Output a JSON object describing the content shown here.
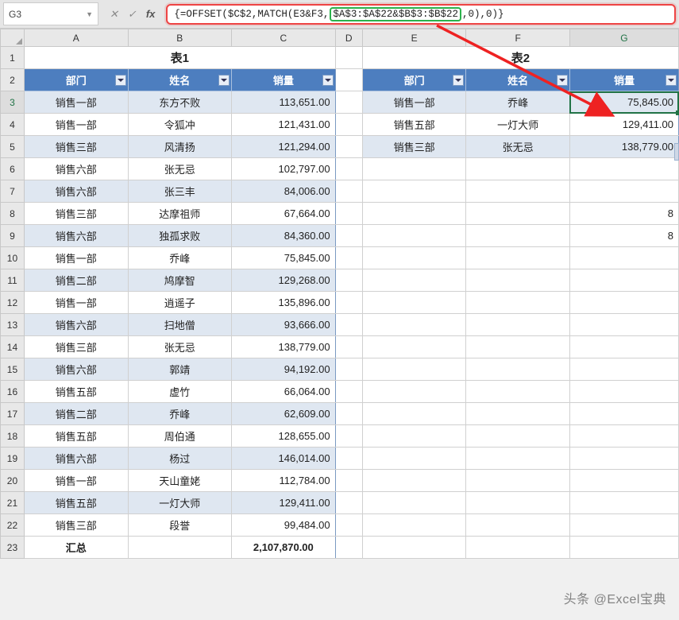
{
  "name_box": "G3",
  "formula": {
    "pre": "{=OFFSET($C$2,MATCH(E3&F3,",
    "hl": "$A$3:$A$22&$B$3:$B$22",
    "post": ",0),0)}"
  },
  "columns": [
    "A",
    "B",
    "C",
    "D",
    "E",
    "F",
    "G"
  ],
  "row_numbers": [
    "1",
    "2",
    "3",
    "4",
    "5",
    "6",
    "7",
    "8",
    "9",
    "10",
    "11",
    "12",
    "13",
    "14",
    "15",
    "16",
    "17",
    "18",
    "19",
    "20",
    "21",
    "22",
    "23"
  ],
  "title_left": "表1",
  "title_right": "表2",
  "headers": {
    "dept": "部门",
    "name": "姓名",
    "sales": "销量"
  },
  "table1": [
    {
      "dept": "销售一部",
      "name": "东方不败",
      "sales": "113,651.00"
    },
    {
      "dept": "销售一部",
      "name": "令狐冲",
      "sales": "121,431.00"
    },
    {
      "dept": "销售三部",
      "name": "风清扬",
      "sales": "121,294.00"
    },
    {
      "dept": "销售六部",
      "name": "张无忌",
      "sales": "102,797.00"
    },
    {
      "dept": "销售六部",
      "name": "张三丰",
      "sales": "84,006.00"
    },
    {
      "dept": "销售三部",
      "name": "达摩祖师",
      "sales": "67,664.00"
    },
    {
      "dept": "销售六部",
      "name": "独孤求败",
      "sales": "84,360.00"
    },
    {
      "dept": "销售一部",
      "name": "乔峰",
      "sales": "75,845.00"
    },
    {
      "dept": "销售二部",
      "name": "鸠摩智",
      "sales": "129,268.00"
    },
    {
      "dept": "销售一部",
      "name": "逍遥子",
      "sales": "135,896.00"
    },
    {
      "dept": "销售六部",
      "name": "扫地僧",
      "sales": "93,666.00"
    },
    {
      "dept": "销售三部",
      "name": "张无忌",
      "sales": "138,779.00"
    },
    {
      "dept": "销售六部",
      "name": "郭靖",
      "sales": "94,192.00"
    },
    {
      "dept": "销售五部",
      "name": "虚竹",
      "sales": "66,064.00"
    },
    {
      "dept": "销售二部",
      "name": "乔峰",
      "sales": "62,609.00"
    },
    {
      "dept": "销售五部",
      "name": "周伯通",
      "sales": "128,655.00"
    },
    {
      "dept": "销售六部",
      "name": "杨过",
      "sales": "146,014.00"
    },
    {
      "dept": "销售一部",
      "name": "天山童姥",
      "sales": "112,784.00"
    },
    {
      "dept": "销售五部",
      "name": "一灯大师",
      "sales": "129,411.00"
    },
    {
      "dept": "销售三部",
      "name": "段誉",
      "sales": "99,484.00"
    }
  ],
  "total_row": {
    "label": "汇总",
    "dept": "",
    "sales": "2,107,870.00"
  },
  "table2": [
    {
      "dept": "销售一部",
      "name": "乔峰",
      "sales": "75,845.00"
    },
    {
      "dept": "销售五部",
      "name": "一灯大师",
      "sales": "129,411.00"
    },
    {
      "dept": "销售三部",
      "name": "张无忌",
      "sales": "138,779.00"
    }
  ],
  "stray": {
    "g8": "8",
    "g9": "8"
  },
  "watermark": "头条 @Excel宝典"
}
